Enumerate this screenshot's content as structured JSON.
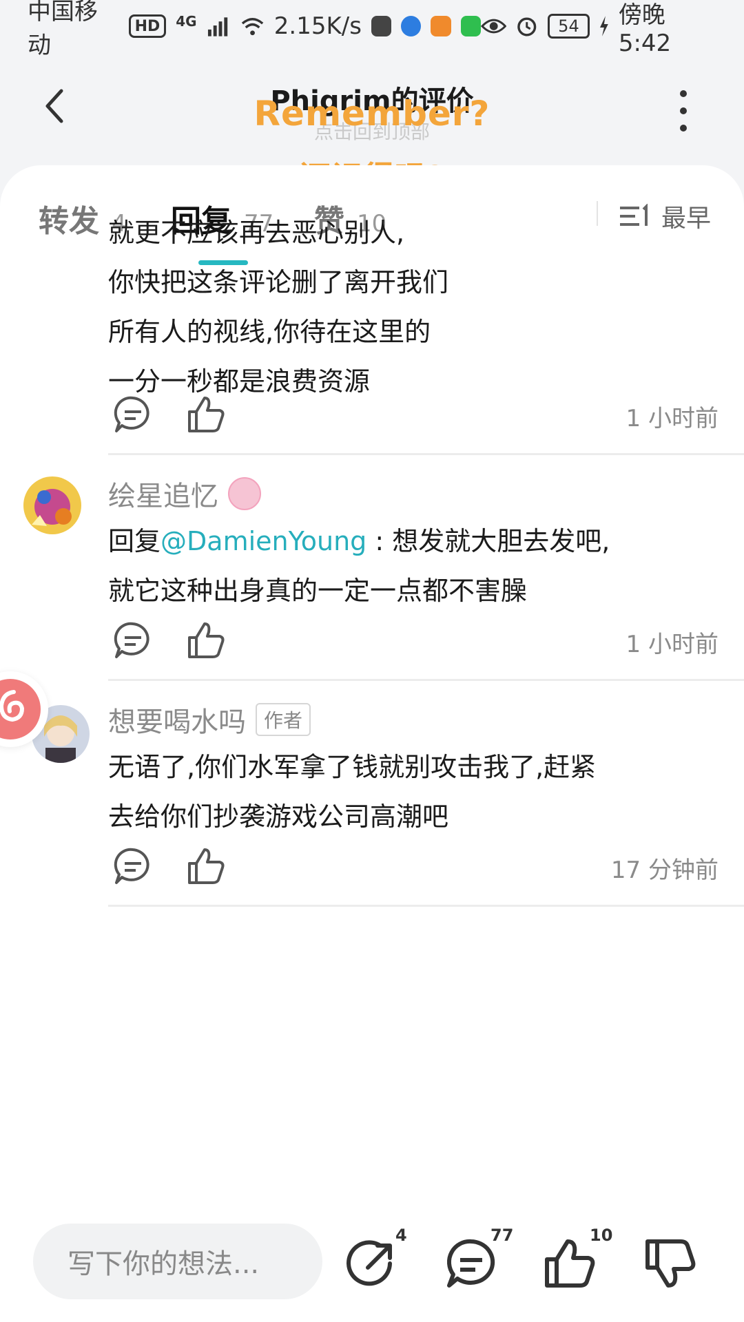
{
  "status_bar": {
    "carrier": "中国移动",
    "hd": "HD",
    "network": "4G",
    "speed": "2.15K/s",
    "battery": "54",
    "time": "傍晚5:42"
  },
  "header": {
    "title": "Phigrim的评价",
    "subtitle": "点击回到顶部",
    "overlay_line1": "Remember?",
    "overlay_line2": "还记得吗?"
  },
  "tabs": [
    {
      "label": "转发",
      "count": "4"
    },
    {
      "label": "回复",
      "count": "77"
    },
    {
      "label": "赞",
      "count": "10"
    }
  ],
  "sort": {
    "label": "最早"
  },
  "comments": [
    {
      "lines": [
        "就更不应该再去恶心别人,",
        "你快把这条评论删了离开我们",
        "所有人的视线,你待在这里的",
        "一分一秒都是浪费资源"
      ],
      "time": "1 小时前"
    },
    {
      "username": "绘星追忆",
      "reply_prefix": "回复",
      "mention": "@DamienYoung",
      "line1_rest": " : 想发就大胆去发吧,",
      "line2": "就它这种出身真的一定一点都不害臊",
      "time": "1 小时前"
    },
    {
      "username": "想要喝水吗",
      "tag": "作者",
      "line1": "无语了,你们水军拿了钱就别攻击我了,赶紧",
      "line2": "去给你们抄袭游戏公司高潮吧",
      "time": "17 分钟前"
    }
  ],
  "bottom_bar": {
    "placeholder": "写下你的想法...",
    "share_count": "4",
    "comment_count": "77",
    "like_count": "10"
  },
  "colors": {
    "accent": "#26b8c1",
    "overlay": "#f3a53b",
    "mention": "#26aebc"
  }
}
